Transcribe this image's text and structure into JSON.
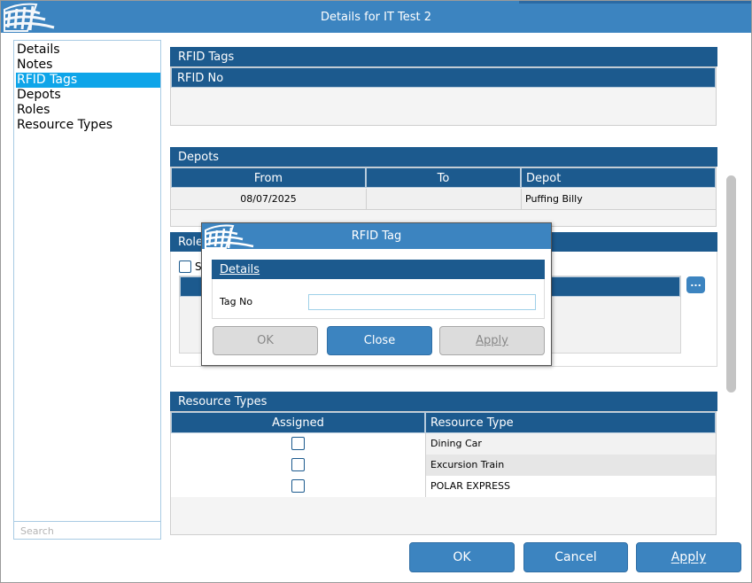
{
  "window": {
    "title": "Details for IT Test 2"
  },
  "nav": {
    "items": [
      {
        "label": "Details"
      },
      {
        "label": "Notes"
      },
      {
        "label": "RFID Tags"
      },
      {
        "label": "Depots"
      },
      {
        "label": "Roles"
      },
      {
        "label": "Resource Types"
      }
    ],
    "selected": "RFID Tags",
    "search_placeholder": "Search"
  },
  "rfid_section": {
    "header": "RFID Tags",
    "columns": [
      "RFID No"
    ],
    "rows": []
  },
  "depots_section": {
    "header": "Depots",
    "columns": [
      "From",
      "To",
      "Depot"
    ],
    "rows": [
      {
        "from": "08/07/2025",
        "to": "",
        "depot": "Puffing Billy"
      }
    ]
  },
  "roles_section": {
    "header_partial": "Role",
    "checkbox_label_partial": "S",
    "ellipsis_label": "..."
  },
  "resource_types_section": {
    "header": "Resource Types",
    "columns": [
      "Assigned",
      "Resource Type"
    ],
    "rows": [
      {
        "assigned": false,
        "type": "Dining Car"
      },
      {
        "assigned": false,
        "type": "Excursion Train"
      },
      {
        "assigned": false,
        "type": "POLAR EXPRESS"
      }
    ]
  },
  "footer": {
    "ok_label": "OK",
    "cancel_label": "Cancel",
    "apply_label": "Apply"
  },
  "dialog": {
    "title": "RFID Tag",
    "section_header": "Details",
    "tag_no_label": "Tag No",
    "tag_no_value": "",
    "ok_label": "OK",
    "close_label": "Close",
    "apply_label": "Apply"
  },
  "colors": {
    "title_bar": "#3c84c0",
    "section_header": "#1c5a8e",
    "selection": "#0ea5e9",
    "button": "#3c84c0"
  }
}
